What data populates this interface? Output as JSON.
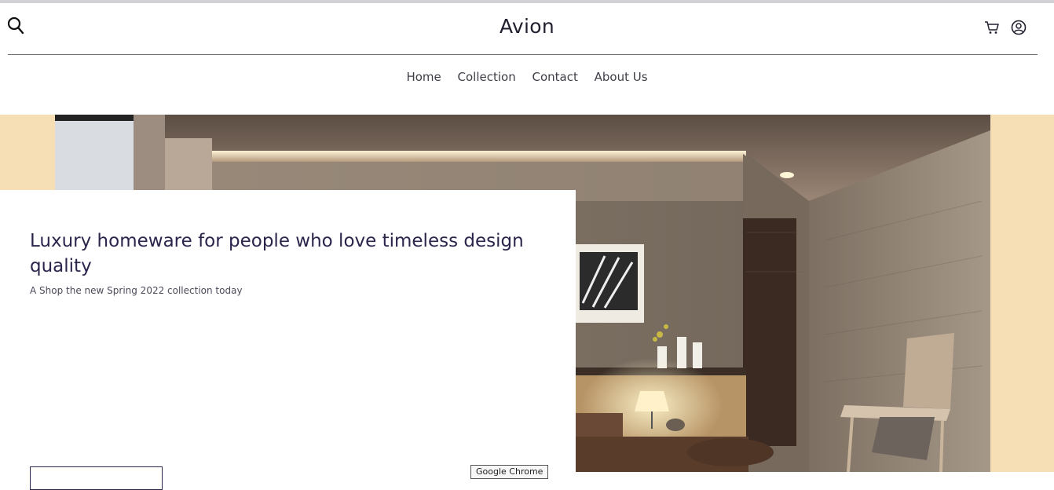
{
  "header": {
    "logo": "Avion",
    "search_icon": "search-icon",
    "cart_icon": "cart-icon",
    "account_icon": "user-circle-icon"
  },
  "nav": {
    "items": [
      "Home",
      "Collection",
      "Contact",
      "About Us"
    ]
  },
  "hero": {
    "headline": "Luxury homeware for people who love timeless design quality",
    "subtext": "A Shop the new Spring 2022 collection today",
    "cta_label": "",
    "tooltip": "Google Chrome"
  },
  "colors": {
    "accent_bg": "#f6dfb4",
    "text_dark": "#2a254b"
  }
}
